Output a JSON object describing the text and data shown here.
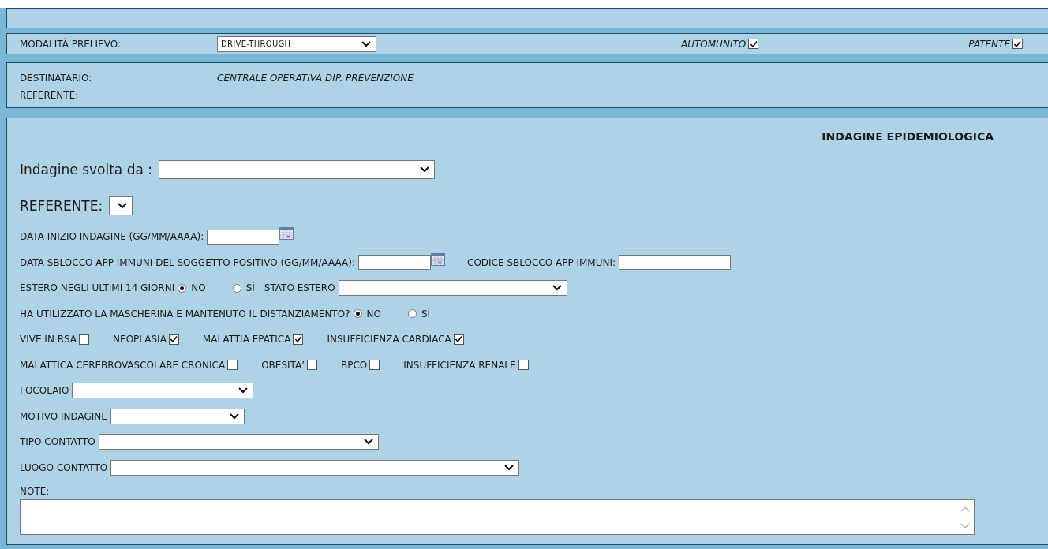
{
  "prelievo": {
    "label": "MODALITÀ PRELIEVO:",
    "value": "DRIVE-THROUGH",
    "checks": [
      {
        "label": "AUTOMUNITO",
        "checked": true
      },
      {
        "label": "PATENTE",
        "checked": true
      }
    ]
  },
  "destinatario": {
    "label": "DESTINATARIO:",
    "value": "CENTRALE OPERATIVA DIP. PREVENZIONE",
    "referente_label": "REFERENTE:"
  },
  "indagine": {
    "title": "INDAGINE EPIDEMIOLOGICA",
    "rows": [
      {
        "kind": "large",
        "items": [
          {
            "kind": "label",
            "text": "Indagine svolta da :"
          },
          {
            "kind": "select"
          }
        ]
      },
      {
        "kind": "large",
        "items": [
          {
            "kind": "label",
            "text": "REFERENTE:"
          },
          {
            "kind": "select"
          }
        ]
      },
      {
        "kind": "normal",
        "items": [
          {
            "kind": "label",
            "text": "DATA INIZIO INDAGINE (GG/MM/AAAA):"
          },
          {
            "kind": "date"
          }
        ]
      },
      {
        "kind": "normal",
        "items": [
          {
            "kind": "label",
            "text": "DATA SBLOCCO APP IMMUNI DEL SOGGETTO POSITIVO (GG/MM/AAAA):"
          },
          {
            "kind": "date"
          },
          {
            "kind": "label",
            "text": "CODICE SBLOCCO APP IMMUNI:"
          },
          {
            "kind": "text"
          }
        ]
      },
      {
        "kind": "normal",
        "items": [
          {
            "kind": "label",
            "text": "ESTERO NEGLI ULTIMI 14 GIORNI"
          },
          {
            "kind": "radio",
            "label": "NO",
            "selected": true
          },
          {
            "kind": "radio",
            "label": "SÌ",
            "selected": false
          },
          {
            "kind": "label",
            "text": "STATO ESTERO"
          },
          {
            "kind": "select"
          }
        ]
      },
      {
        "kind": "normal",
        "items": [
          {
            "kind": "label",
            "text": "HA UTILIZZATO LA MASCHERINA E MANTENUTO IL DISTANZIAMENTO?"
          },
          {
            "kind": "radio",
            "label": "NO",
            "selected": true
          },
          {
            "kind": "radio",
            "label": "SÌ",
            "selected": false
          }
        ]
      },
      {
        "kind": "normal",
        "items": [
          {
            "kind": "checkbox",
            "label": "VIVE IN RSA",
            "checked": false
          },
          {
            "kind": "checkbox",
            "label": "NEOPLASIA",
            "checked": true
          },
          {
            "kind": "checkbox",
            "label": "MALATTIA EPATICA",
            "checked": true
          },
          {
            "kind": "checkbox",
            "label": "INSUFFICIENZA CARDIACA",
            "checked": true
          }
        ]
      },
      {
        "kind": "normal",
        "items": [
          {
            "kind": "checkbox",
            "label": "MALATTICA CEREBROVASCOLARE CRONICA",
            "checked": false
          },
          {
            "kind": "checkbox",
            "label": "OBESITA’",
            "checked": false
          },
          {
            "kind": "checkbox",
            "label": "BPCO",
            "checked": false
          },
          {
            "kind": "checkbox",
            "label": "INSUFFICIENZA RENALE",
            "checked": false
          }
        ]
      },
      {
        "kind": "normal",
        "items": [
          {
            "kind": "label",
            "text": "FOCOLAIO"
          },
          {
            "kind": "select"
          }
        ]
      },
      {
        "kind": "normal",
        "items": [
          {
            "kind": "label",
            "text": "MOTIVO INDAGINE"
          },
          {
            "kind": "select"
          }
        ]
      },
      {
        "kind": "normal",
        "items": [
          {
            "kind": "label",
            "text": "TIPO CONTATTO"
          },
          {
            "kind": "select"
          }
        ]
      },
      {
        "kind": "normal",
        "items": [
          {
            "kind": "label",
            "text": "LUOGO CONTATTO"
          },
          {
            "kind": "select"
          }
        ]
      }
    ],
    "note_label": "NOTE:"
  }
}
